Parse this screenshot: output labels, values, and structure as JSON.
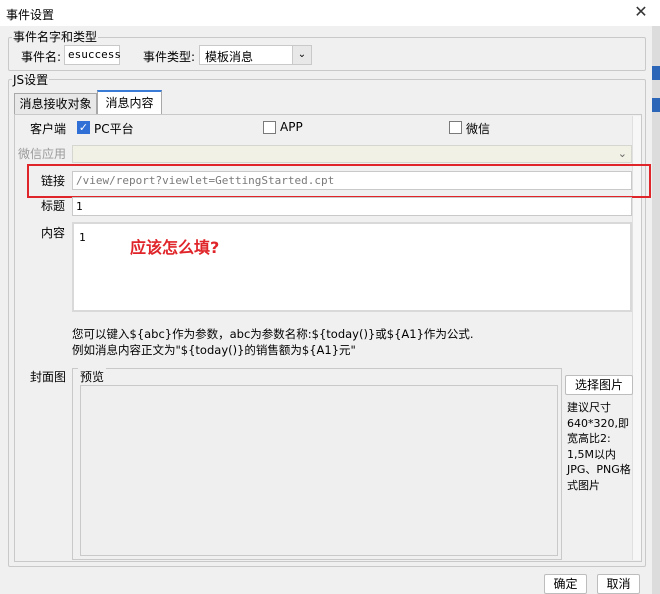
{
  "window": {
    "title": "事件设置",
    "close_icon": "close-icon"
  },
  "name_section": {
    "legend": "事件名字和类型",
    "event_name_label": "事件名:",
    "event_name_value": "esuccess",
    "event_type_label": "事件类型:",
    "event_type_value": "模板消息"
  },
  "js_section": {
    "legend": "JS设置",
    "tabs": [
      {
        "label": "消息接收对象"
      },
      {
        "label": "消息内容"
      }
    ],
    "client_label": "客户端",
    "clients": [
      {
        "label": "PC平台",
        "checked": true
      },
      {
        "label": "APP",
        "checked": false
      },
      {
        "label": "微信",
        "checked": false
      }
    ],
    "wechat_app_label": "微信应用",
    "link_label": "链接",
    "link_value": "/view/report?viewlet=GettingStarted.cpt",
    "title_label": "标题",
    "title_value": "1",
    "content_label": "内容",
    "content_value": "1",
    "annotation": "应该怎么填?",
    "hint_line1": "您可以键入${abc}作为参数，abc为参数名称:${today()}或${A1}作为公式.",
    "hint_line2": "例如消息内容正文为\"${today()}的销售额为${A1}元\"",
    "cover_label": "封面图",
    "preview_label": "预览",
    "select_image_button": "选择图片",
    "size_hint_lines": [
      "建议尺寸",
      "640*320,即",
      "宽高比2:",
      "1,5M以内",
      "JPG、PNG格",
      "式图片"
    ]
  },
  "footer": {
    "ok": "确定",
    "cancel": "取消"
  },
  "colors": {
    "highlight": "#e0252a",
    "checkbox_checked": "#2f6fd6"
  }
}
